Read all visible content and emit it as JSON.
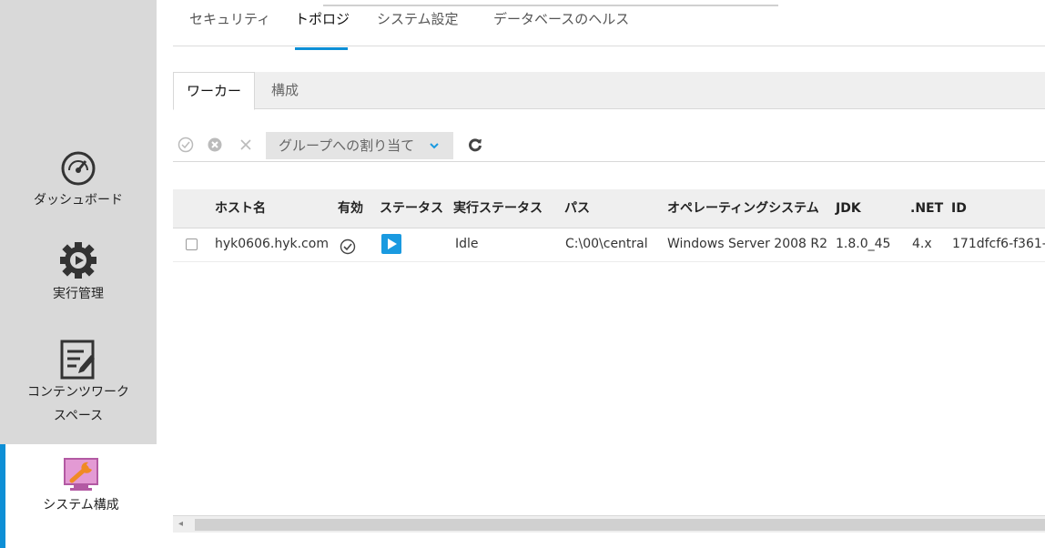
{
  "sidebar": {
    "items": [
      {
        "label": "ダッシュボード",
        "icon": "speedometer-icon"
      },
      {
        "label": "実行管理",
        "icon": "gear-play-icon"
      },
      {
        "label1": "コンテンツワーク",
        "label2": "スペース",
        "icon": "edit-document-icon"
      },
      {
        "label": "システム構成",
        "icon": "wrench-monitor-icon",
        "active": true
      }
    ]
  },
  "top_tabs": [
    "セキュリティ",
    "トポロジ",
    "システム設定",
    "データベースのヘルス"
  ],
  "sub_tabs": [
    "ワーカー",
    "構成"
  ],
  "toolbar": {
    "enable_icon": "check-circle-icon",
    "disable_icon": "x-circle-icon",
    "delete_icon": "close-icon",
    "assign_group_label": "グループへの割り当て",
    "refresh_icon": "refresh-icon"
  },
  "table": {
    "headers": [
      "ホスト名",
      "有効",
      "ステータス",
      "実行ステータス",
      "パス",
      "オペレーティングシステム",
      "JDK",
      ".NET",
      "ID"
    ],
    "rows": [
      {
        "host": "hyk0606.hyk.com",
        "enabled_icon": "check-circle-icon",
        "status_icon": "play-icon",
        "exec_status": "Idle",
        "path": "C:\\00\\central",
        "os": "Windows Server 2008 R2",
        "jdk": "1.8.0_45",
        "net": "4.x",
        "id": "171dfcf6-f361-"
      }
    ]
  },
  "colors": {
    "accent": "#0d8fd6",
    "sidebar": "#d9d9d9",
    "status_play": "#1a9ae0"
  }
}
